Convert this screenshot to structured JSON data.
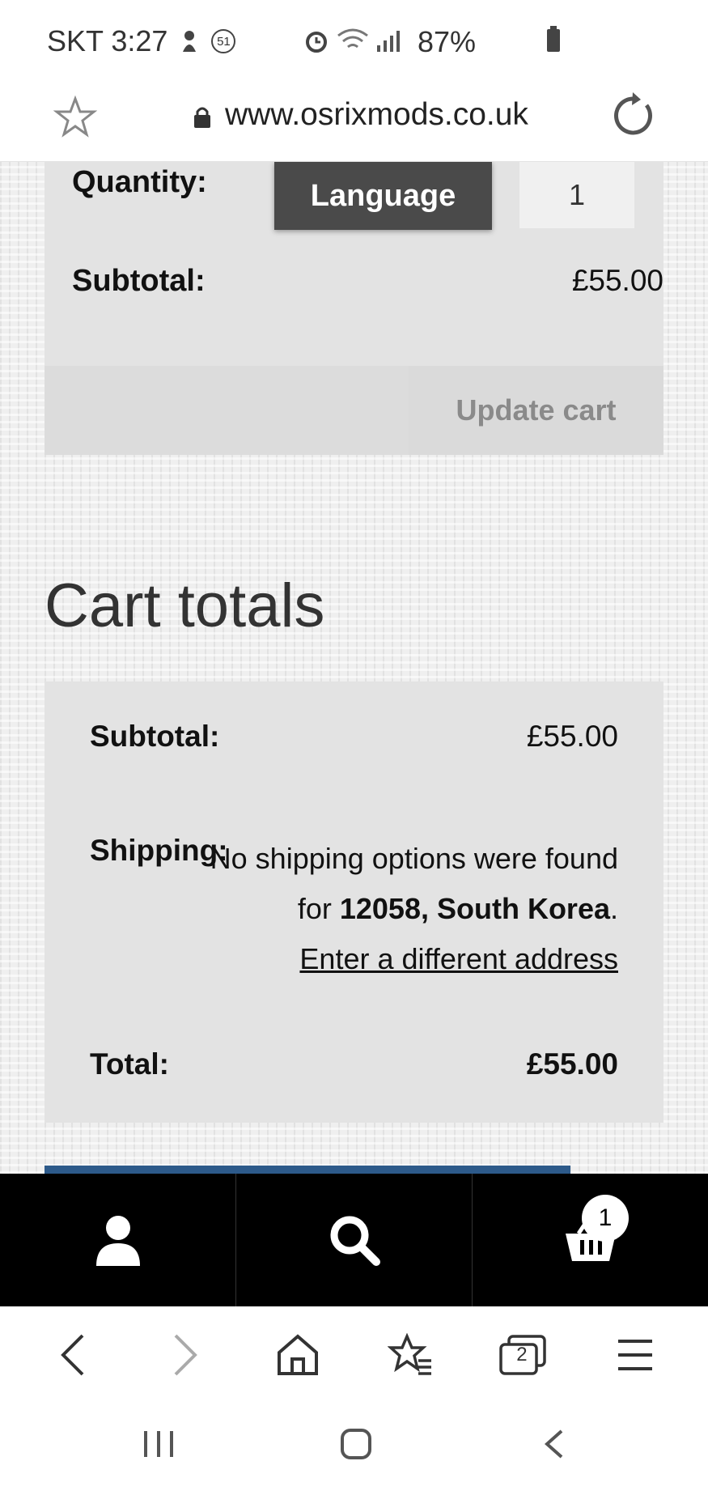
{
  "status_bar": {
    "carrier_time": "SKT 3:27",
    "notification_count": "51",
    "battery": "87%"
  },
  "url_bar": {
    "url": "www.osrixmods.co.uk"
  },
  "cart_item": {
    "quantity_label": "Quantity:",
    "quantity_value": "1",
    "subtotal_label": "Subtotal:",
    "subtotal_value": "£55.00",
    "language_button": "Language",
    "update_cart_button": "Update cart"
  },
  "cart_totals": {
    "title": "Cart totals",
    "subtotal_label": "Subtotal:",
    "subtotal_value": "£55.00",
    "shipping_label": "Shipping:",
    "shipping_text_before": "No shipping options were found for ",
    "shipping_location": "12058, South Korea",
    "shipping_text_after": ".",
    "different_address_link": "Enter a different address",
    "total_label": "Total:",
    "total_value": "£55.00"
  },
  "site_nav": {
    "items": [
      "account-icon",
      "search-icon",
      "basket-icon"
    ],
    "basket_count": "1"
  },
  "browser_toolbar": {
    "items": [
      "back-icon",
      "forward-icon",
      "home-icon",
      "bookmarks-icon",
      "tabs-icon",
      "menu-icon"
    ],
    "tabs_count": "2"
  },
  "android_nav": {
    "items": [
      "recents-icon",
      "home-button-icon",
      "back-nav-icon"
    ]
  }
}
